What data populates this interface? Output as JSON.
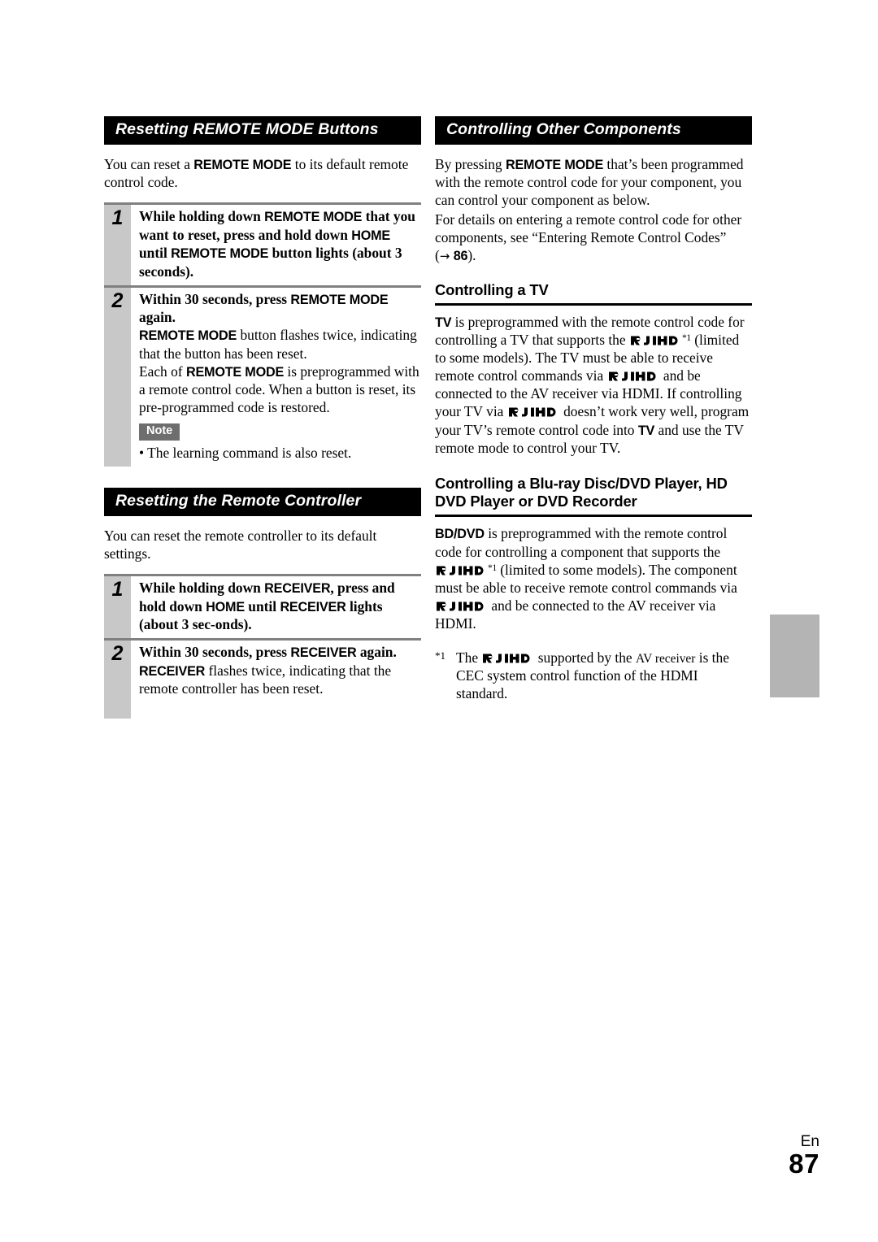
{
  "page": {
    "language_label": "En",
    "page_number": "87",
    "side_tab_color": "#b4b4b4",
    "header_bar_color": "#000000",
    "step_number_column_color": "#c8c8c8",
    "note_badge_color": "#6e6e6e"
  },
  "left_column": {
    "section1": {
      "heading": "Resetting REMOTE MODE Buttons",
      "intro": {
        "part1": "You can reset a ",
        "bold1": "REMOTE MODE",
        "part2": " to its default remote control code."
      },
      "steps": [
        {
          "number": "1",
          "lead_part1": "While holding down ",
          "lead_bold1": "REMOTE MODE",
          "lead_part2": " that you want to reset, press and hold down ",
          "lead_bold2": "HOME",
          "lead_part3": " until ",
          "lead_bold3": "REMOTE MODE",
          "lead_part4": " button lights (about 3 seconds)."
        },
        {
          "number": "2",
          "lead_part1": "Within 30 seconds, press ",
          "lead_bold1": "REMOTE MODE",
          "lead_part2": " again.",
          "body1_bold": "REMOTE MODE",
          "body1_text": " button flashes twice, indicating that the button has been reset.",
          "body2_pre": "Each of ",
          "body2_bold": "REMOTE MODE",
          "body2_text": " is preprogrammed with a remote control code. When a button is reset, its pre-programmed code is restored.",
          "note_badge": "Note",
          "note_items": [
            "• The learning command is also reset."
          ]
        }
      ]
    },
    "section2": {
      "heading": "Resetting the Remote Controller",
      "intro": "You can reset the remote controller to its default settings.",
      "steps": [
        {
          "number": "1",
          "lead_part1": "While holding down ",
          "lead_bold1": "RECEIVER",
          "lead_part2": ", press and hold down ",
          "lead_bold2": "HOME",
          "lead_part3": " until ",
          "lead_bold3": "RECEIVER",
          "lead_part4": " lights (about 3 sec-onds)."
        },
        {
          "number": "2",
          "lead_part1": "Within 30 seconds, press ",
          "lead_bold1": "RECEIVER",
          "lead_part2": " again.",
          "body1_bold": "RECEIVER",
          "body1_text": " flashes twice, indicating that the remote controller has been reset."
        }
      ]
    }
  },
  "right_column": {
    "section_heading": "Controlling Other Components",
    "intro_para1": {
      "part1": "By pressing ",
      "bold1": "REMOTE MODE",
      "part2": " that’s been programmed with the remote control code for your component, you can control your component as below."
    },
    "intro_para2": {
      "part1": "For details on entering a remote control code for other components, see “Entering Remote Control Codes” (",
      "arrow": "→",
      "page_ref": "86",
      "part2": ")."
    },
    "tv_section": {
      "heading": "Controlling a TV",
      "p1_bold": "TV",
      "p1_a": " is preprogrammed with the remote control code for controlling a TV that supports the ",
      "p1_logo1": "rihd-logo",
      "p1_sup1": "*1",
      "p1_b": " (limited to some models). The TV must be able to receive remote control commands via ",
      "p1_logo2": "rihd-logo",
      "p1_c": " and be connected to the AV receiver via HDMI. If controlling your TV via ",
      "p1_logo3": "rihd-logo",
      "p1_d": " doesn’t work very well, program your TV’s remote control code into ",
      "p1_bold2": "TV",
      "p1_e": " and use the TV remote mode to control your TV."
    },
    "bddvd_section": {
      "heading_line1": "Controlling a Blu-ray Disc/DVD Player, HD",
      "heading_line2": "DVD Player or DVD Recorder",
      "p1_bold": "BD/DVD",
      "p1_a": " is preprogrammed with the remote control code for controlling a component that supports the ",
      "p1_logo1": "rihd-logo",
      "p1_sup1": "*1",
      "p1_b": " (limited to some models). The component must be able to receive remote control commands via ",
      "p1_logo2": "rihd-logo",
      "p1_c": " and be connected to the AV receiver via HDMI."
    },
    "footnote": {
      "mark": "*1",
      "a": "The ",
      "logo": "rihd-logo",
      "b": " supported by the ",
      "av_receiver": "AV receiver",
      "c": " is the CEC system control function of the HDMI standard."
    }
  }
}
